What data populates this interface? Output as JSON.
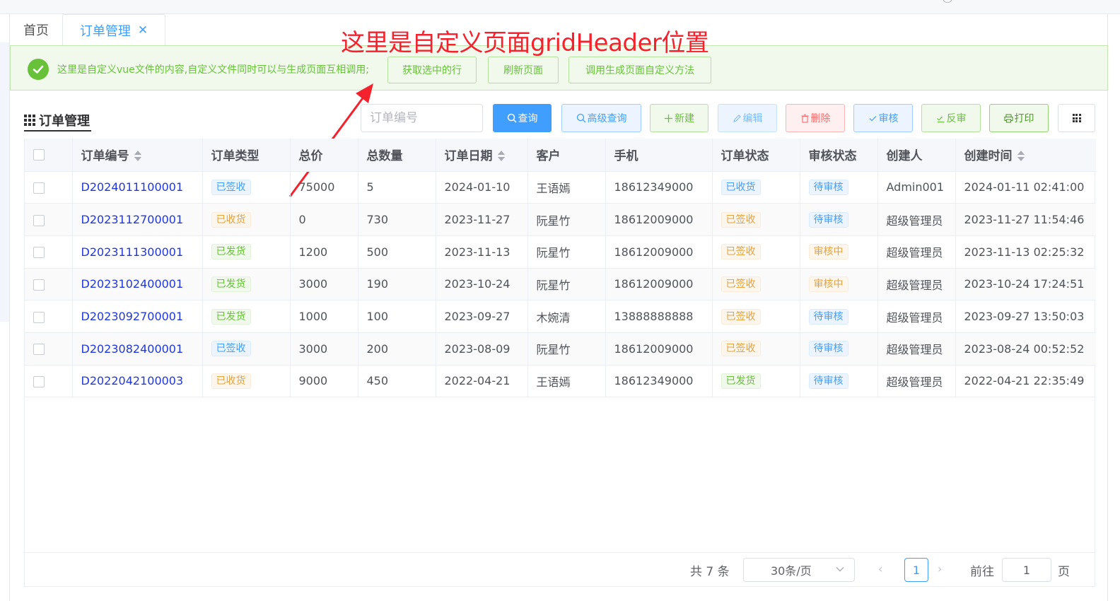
{
  "tabs": [
    {
      "label": "首页"
    },
    {
      "label": "订单管理",
      "close": "✕"
    }
  ],
  "banner": {
    "text": "这里是自定义vue文件的内容,自定义文件同时可以与生成页面互相调用;",
    "buttons": [
      "获取选中的行",
      "刷新页面",
      "调用生成页面自定义方法"
    ]
  },
  "annotation": "这里是自定义页面gridHeader位置",
  "section_title": "订单管理",
  "search": {
    "placeholder": "订单编号",
    "value": ""
  },
  "toolbar": {
    "query": "查询",
    "advanced_query": "高级查询",
    "create": "新建",
    "edit": "编辑",
    "delete": "删除",
    "audit": "审核",
    "unaudit": "反审",
    "print": "打印"
  },
  "table": {
    "columns": [
      "订单编号",
      "订单类型",
      "总价",
      "总数量",
      "订单日期",
      "客户",
      "手机",
      "订单状态",
      "审核状态",
      "创建人",
      "创建时间"
    ],
    "rows": [
      {
        "order_no": "D2024011100001",
        "type": "已签收",
        "type_color": "blue",
        "total": "75000",
        "qty": "5",
        "date": "2024-01-10",
        "customer": "王语嫣",
        "phone": "18612349000",
        "status": "已收货",
        "status_color": "blue",
        "audit": "待审核",
        "audit_color": "blue",
        "creator": "Admin001",
        "created": "2024-01-11 02:41:00"
      },
      {
        "order_no": "D2023112700001",
        "type": "已收货",
        "type_color": "orange",
        "total": "0",
        "qty": "730",
        "date": "2023-11-27",
        "customer": "阮星竹",
        "phone": "18612009000",
        "status": "已签收",
        "status_color": "orange",
        "audit": "待审核",
        "audit_color": "blue",
        "creator": "超级管理员",
        "created": "2023-11-27 11:54:46"
      },
      {
        "order_no": "D2023111300001",
        "type": "已发货",
        "type_color": "green",
        "total": "1200",
        "qty": "500",
        "date": "2023-11-13",
        "customer": "阮星竹",
        "phone": "18612009000",
        "status": "已签收",
        "status_color": "orange",
        "audit": "审核中",
        "audit_color": "orange",
        "creator": "超级管理员",
        "created": "2023-11-13 02:25:32"
      },
      {
        "order_no": "D2023102400001",
        "type": "已发货",
        "type_color": "green",
        "total": "3000",
        "qty": "190",
        "date": "2023-10-24",
        "customer": "阮星竹",
        "phone": "18612009000",
        "status": "已签收",
        "status_color": "orange",
        "audit": "审核中",
        "audit_color": "orange",
        "creator": "超级管理员",
        "created": "2023-10-24 17:24:51"
      },
      {
        "order_no": "D2023092700001",
        "type": "已发货",
        "type_color": "green",
        "total": "1000",
        "qty": "100",
        "date": "2023-09-27",
        "customer": "木婉清",
        "phone": "13888888888",
        "status": "已签收",
        "status_color": "orange",
        "audit": "待审核",
        "audit_color": "blue",
        "creator": "超级管理员",
        "created": "2023-09-27 13:50:03"
      },
      {
        "order_no": "D2023082400001",
        "type": "已签收",
        "type_color": "blue",
        "total": "3000",
        "qty": "200",
        "date": "2023-08-09",
        "customer": "阮星竹",
        "phone": "18612009000",
        "status": "已签收",
        "status_color": "orange",
        "audit": "待审核",
        "audit_color": "blue",
        "creator": "超级管理员",
        "created": "2023-08-24 00:52:52"
      },
      {
        "order_no": "D2022042100003",
        "type": "已收货",
        "type_color": "orange",
        "total": "9000",
        "qty": "450",
        "date": "2022-04-21",
        "customer": "王语嫣",
        "phone": "18612349000",
        "status": "已发货",
        "status_color": "green",
        "audit": "待审核",
        "audit_color": "blue",
        "creator": "超级管理员",
        "created": "2022-04-21 22:35:49"
      }
    ]
  },
  "pagination": {
    "total": "共 7 条",
    "page_size": "30条/页",
    "prev": "‹",
    "current": "1",
    "next": "›",
    "goto_label": "前往",
    "goto_value": "1",
    "page_suffix": "页"
  },
  "colors": {
    "primary": "#409eff",
    "success": "#67c23a",
    "warning": "#e6a23c",
    "danger": "#f56c6c",
    "annotation": "#f5222d",
    "link": "#2137d9"
  }
}
